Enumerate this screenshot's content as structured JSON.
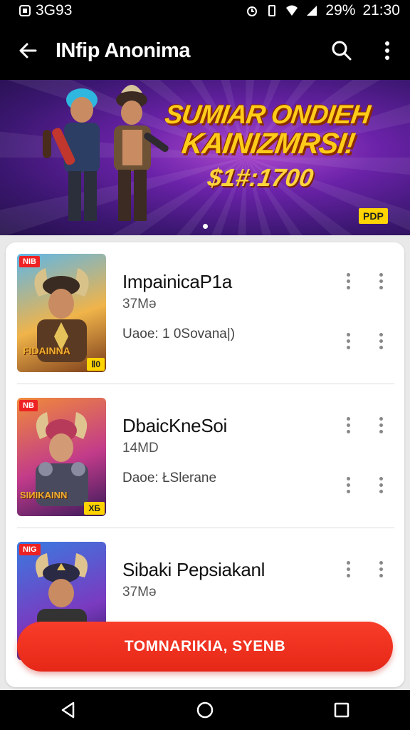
{
  "status_bar": {
    "left_text": "3G93",
    "battery": "29%",
    "time": "21:30"
  },
  "app_bar": {
    "title": "INfip Anonima",
    "back_icon": "arrow-back-icon",
    "search_icon": "search-icon",
    "menu_icon": "more-vert-icon"
  },
  "banner": {
    "line1": "SUMIAR ONDIEH",
    "line2": "KAINIZMRSI!",
    "line3": "$1#:1700",
    "tag": "PDP",
    "colors": {
      "bg": "#6a22a8",
      "text": "#ffcc1a"
    }
  },
  "items": [
    {
      "name": "ImpainicaΡ1a",
      "size": "37Mə",
      "meta": "Uaoe: 1 0Sovana|)",
      "badge": "NIB",
      "corner": "Ⅱ0",
      "title_art": "FIDAINNA"
    },
    {
      "name": "DbaicKneSoi",
      "size": "14MD",
      "meta": "Daoe: ŁSlerane",
      "badge": "NB",
      "corner": "ХБ",
      "title_art": "SIИIKAINN"
    },
    {
      "name": "Sibaki Pepsiakanl",
      "size": "37Mə",
      "meta": "",
      "badge": "NIG",
      "corner": "",
      "title_art": ""
    }
  ],
  "cta": {
    "label": "TOMNARIKIA, SYENB"
  },
  "nav": {
    "back": "nav-back-icon",
    "home": "nav-home-icon",
    "recents": "nav-recents-icon"
  }
}
